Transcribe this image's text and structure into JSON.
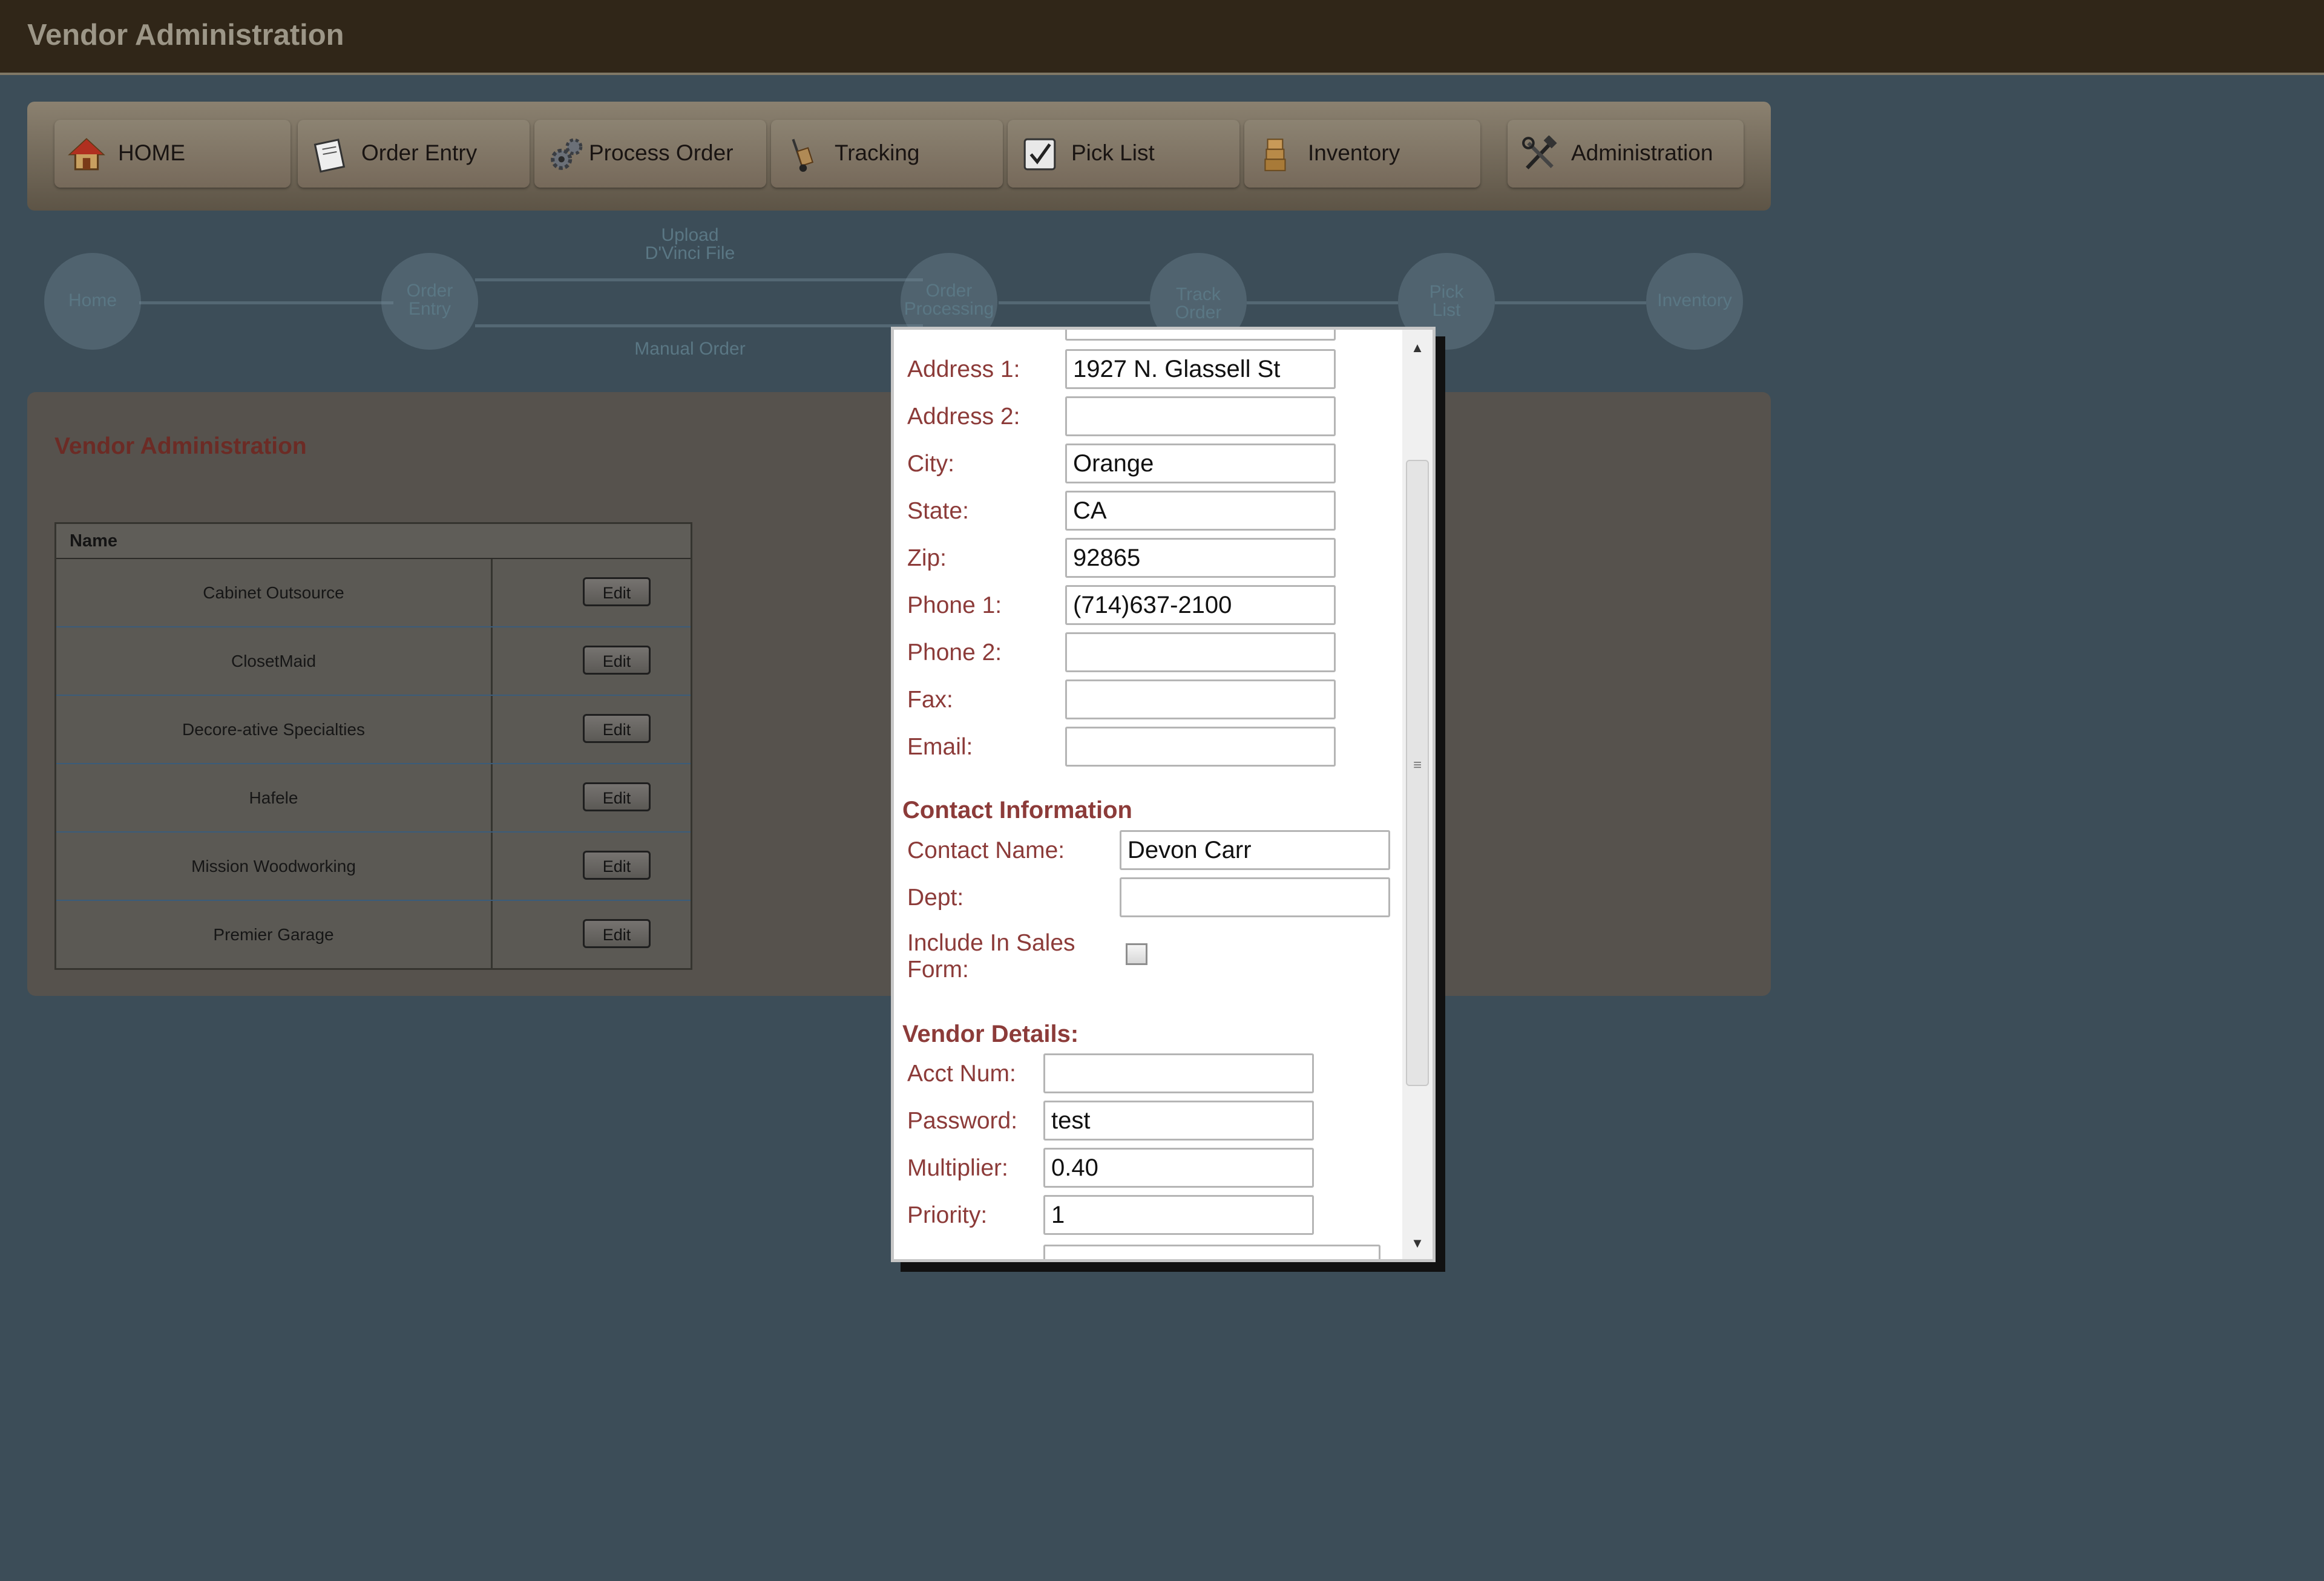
{
  "app_title": "Vendor Administration",
  "nav": [
    {
      "label": "HOME",
      "icon": "home-icon"
    },
    {
      "label": "Order Entry",
      "icon": "notepad-icon"
    },
    {
      "label": "Process Order",
      "icon": "gears-icon"
    },
    {
      "label": "Tracking",
      "icon": "hand-truck-icon"
    },
    {
      "label": "Pick List",
      "icon": "checkbox-icon"
    },
    {
      "label": "Inventory",
      "icon": "boxes-icon"
    },
    {
      "label": "Administration",
      "icon": "tools-icon"
    }
  ],
  "workflow": {
    "home": "Home",
    "order_entry_1": "Order",
    "order_entry_2": "Entry",
    "upload_1": "Upload",
    "upload_2": "D'Vinci File",
    "manual": "Manual Order",
    "processing_1": "Order",
    "processing_2": "Processing",
    "track_1": "Track",
    "track_2": "Order",
    "pick_1": "Pick",
    "pick_2": "List",
    "inventory": "Inventory"
  },
  "panel": {
    "title": "Vendor Administration",
    "column_name": "Name",
    "edit_label": "Edit",
    "vendors": [
      "Cabinet Outsource",
      "ClosetMaid",
      "Decore-ative Specialties",
      "Hafele",
      "Mission Woodworking",
      "Premier Garage"
    ]
  },
  "modal": {
    "address": {
      "address1_label": "Address 1:",
      "address1_value": "1927 N. Glassell St",
      "address2_label": "Address 2:",
      "address2_value": "",
      "city_label": "City:",
      "city_value": "Orange",
      "state_label": "State:",
      "state_value": "CA",
      "zip_label": "Zip:",
      "zip_value": "92865",
      "phone1_label": "Phone 1:",
      "phone1_value": "(714)637-2100",
      "phone2_label": "Phone 2:",
      "phone2_value": "",
      "fax_label": "Fax:",
      "fax_value": "",
      "email_label": "Email:",
      "email_value": ""
    },
    "contact": {
      "heading": "Contact Information",
      "name_label": "Contact Name:",
      "name_value": "Devon Carr",
      "dept_label": "Dept:",
      "dept_value": "",
      "include_label_1": "Include In Sales",
      "include_label_2": "Form:",
      "include_checked": false
    },
    "details": {
      "heading": "Vendor Details:",
      "acct_label": "Acct Num:",
      "acct_value": "",
      "password_label": "Password:",
      "password_value": "test",
      "multiplier_label": "Multiplier:",
      "multiplier_value": "0.40",
      "priority_label": "Priority:",
      "priority_value": "1"
    },
    "scroll_up": "▲",
    "scroll_down": "▼"
  }
}
